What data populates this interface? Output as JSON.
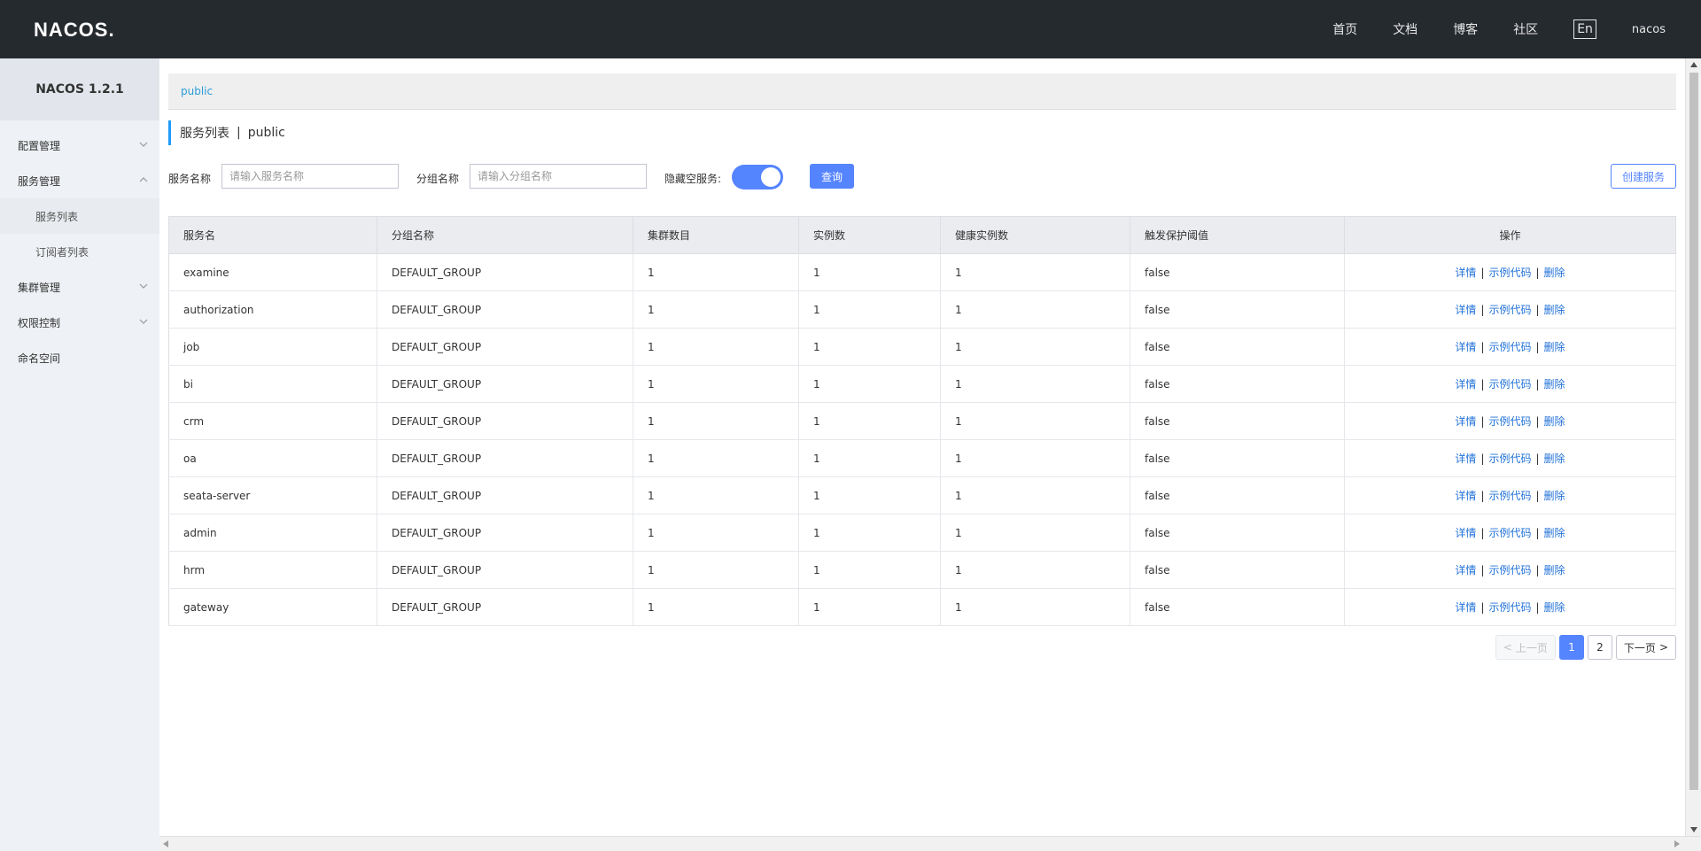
{
  "header": {
    "logo_text": "NACOS.",
    "nav": [
      "首页",
      "文档",
      "博客",
      "社区"
    ],
    "lang": "En",
    "user": "nacos"
  },
  "sidebar": {
    "title": "NACOS 1.2.1",
    "items": [
      {
        "label": "配置管理",
        "expanded": false
      },
      {
        "label": "服务管理",
        "expanded": true,
        "children": [
          "服务列表",
          "订阅者列表"
        ]
      },
      {
        "label": "集群管理",
        "expanded": false
      },
      {
        "label": "权限控制",
        "expanded": false
      },
      {
        "label": "命名空间"
      }
    ]
  },
  "namespace_bar": {
    "current": "public"
  },
  "page": {
    "title": "服务列表",
    "separator": "|",
    "namespace": "public"
  },
  "filters": {
    "service_name_label": "服务名称",
    "service_name_placeholder": "请输入服务名称",
    "group_name_label": "分组名称",
    "group_name_placeholder": "请输入分组名称",
    "hide_empty_label": "隐藏空服务:",
    "hide_empty_on": true,
    "query_button": "查询",
    "create_button": "创建服务"
  },
  "table": {
    "columns": [
      "服务名",
      "分组名称",
      "集群数目",
      "实例数",
      "健康实例数",
      "触发保护阈值",
      "操作"
    ],
    "actions": [
      "详情",
      "示例代码",
      "删除"
    ],
    "action_sep": "|",
    "rows": [
      [
        "examine",
        "DEFAULT_GROUP",
        "1",
        "1",
        "1",
        "false"
      ],
      [
        "authorization",
        "DEFAULT_GROUP",
        "1",
        "1",
        "1",
        "false"
      ],
      [
        "job",
        "DEFAULT_GROUP",
        "1",
        "1",
        "1",
        "false"
      ],
      [
        "bi",
        "DEFAULT_GROUP",
        "1",
        "1",
        "1",
        "false"
      ],
      [
        "crm",
        "DEFAULT_GROUP",
        "1",
        "1",
        "1",
        "false"
      ],
      [
        "oa",
        "DEFAULT_GROUP",
        "1",
        "1",
        "1",
        "false"
      ],
      [
        "seata-server",
        "DEFAULT_GROUP",
        "1",
        "1",
        "1",
        "false"
      ],
      [
        "admin",
        "DEFAULT_GROUP",
        "1",
        "1",
        "1",
        "false"
      ],
      [
        "hrm",
        "DEFAULT_GROUP",
        "1",
        "1",
        "1",
        "false"
      ],
      [
        "gateway",
        "DEFAULT_GROUP",
        "1",
        "1",
        "1",
        "false"
      ]
    ]
  },
  "pagination": {
    "prev": "上一页",
    "next": "下一页",
    "pages": [
      "1",
      "2"
    ],
    "current": "1"
  },
  "colors": {
    "header_bg": "#252a2f",
    "accent": "#5584ff",
    "link": "#2272d8",
    "ns_link": "#2c9bd8",
    "sidebar_bg": "#eef1f5"
  }
}
